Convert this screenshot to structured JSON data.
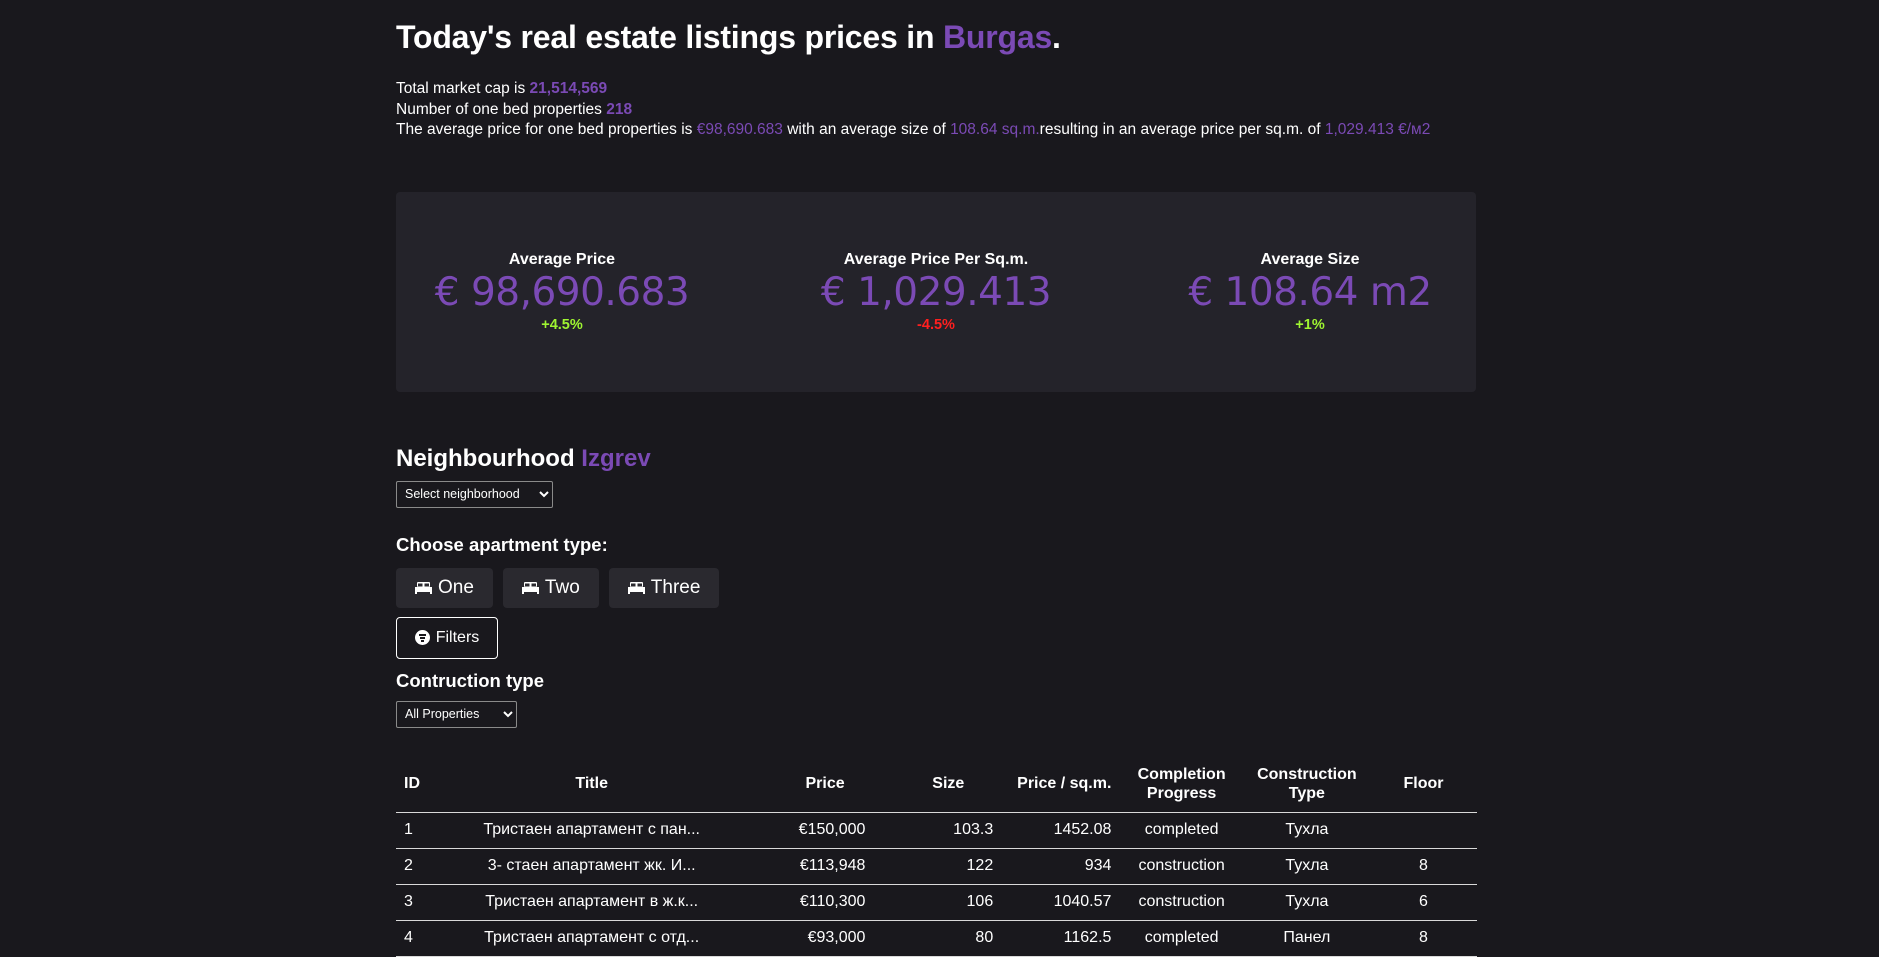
{
  "colors": {
    "accent": "#7b4ab5",
    "up": "#9ff531",
    "down": "#ff1f1f",
    "background": "#19181d",
    "panel": "#24232a"
  },
  "header": {
    "title_prefix": "Today's real estate listings prices in ",
    "city": "Burgas",
    "title_suffix": "."
  },
  "summary": {
    "market_cap_label": "Total market cap is ",
    "market_cap_value": "21,514,569",
    "count_label": "Number of one bed properties ",
    "count_value": "218",
    "avg_text_1": "The average price for one bed properties is ",
    "avg_price": "€98,690.683",
    "avg_text_2": " with an average size of ",
    "avg_size": "108.64 sq.m.",
    "avg_text_3": "resulting in an average price per sq.m. of ",
    "avg_ppsqm": "1,029.413 €/м2"
  },
  "stats": [
    {
      "label": "Average Price",
      "value": "€ 98,690.683",
      "change": "+4.5%",
      "direction": "up"
    },
    {
      "label": "Average Price Per Sq.m.",
      "value": "€ 1,029.413",
      "change": "-4.5%",
      "direction": "down"
    },
    {
      "label": "Average Size",
      "value": "€ 108.64 m2",
      "change": "+1%",
      "direction": "up"
    }
  ],
  "neighbourhood": {
    "label": "Neighbourhood ",
    "value": "Izgrev",
    "select_value": "Select neighborhood"
  },
  "apartment_type": {
    "label": "Choose apartment type:",
    "icon": "bed-icon",
    "buttons": [
      "One",
      "Two",
      "Three"
    ]
  },
  "filters": {
    "label": "Filters",
    "icon": "filter-icon"
  },
  "construction": {
    "label": "Contruction type",
    "select_value": "All Properties"
  },
  "table": {
    "headers": [
      "ID",
      "Title",
      "Price",
      "Size",
      "Price / sq.m.",
      "Completion Progress",
      "Construction Type",
      "Floor"
    ],
    "rows": [
      [
        "1",
        "Тристаен апартамент с пан...",
        "€150,000",
        "103.3",
        "1452.08",
        "completed",
        "Тухла",
        ""
      ],
      [
        "2",
        "3- стаен апартамент жк. И...",
        "€113,948",
        "122",
        "934",
        "construction",
        "Тухла",
        "8"
      ],
      [
        "3",
        "Тристаен апартамент в ж.к...",
        "€110,300",
        "106",
        "1040.57",
        "construction",
        "Тухла",
        "6"
      ],
      [
        "4",
        "Тристаен апартамент с отд...",
        "€93,000",
        "80",
        "1162.5",
        "completed",
        "Панел",
        "8"
      ]
    ]
  }
}
